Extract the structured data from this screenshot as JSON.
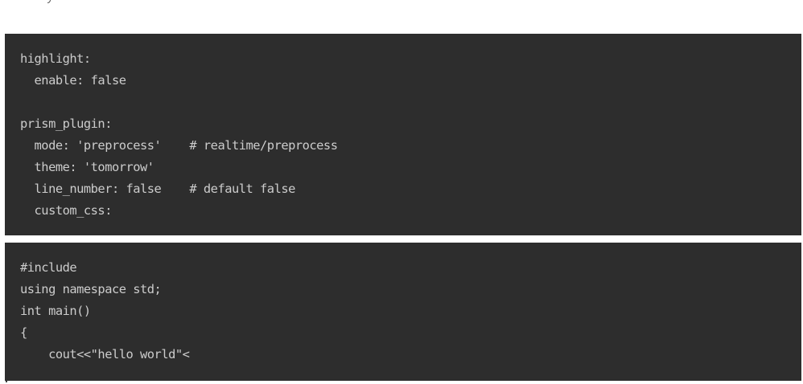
{
  "colors": {
    "page_background": "#ffffff",
    "code_background": "#2d2d2d",
    "code_text": "#cccccc"
  },
  "code_blocks": [
    {
      "language": "yaml",
      "lines": [
        "highlight:",
        "  enable: false",
        "",
        "prism_plugin:",
        "  mode: 'preprocess'    # realtime/preprocess",
        "  theme: 'tomorrow'",
        "  line_number: false    # default false",
        "  custom_css:"
      ]
    },
    {
      "language": "cpp",
      "lines": [
        "#include",
        "using namespace std;",
        "int main()",
        "{",
        "    cout<<\"hello world\"<"
      ]
    }
  ]
}
